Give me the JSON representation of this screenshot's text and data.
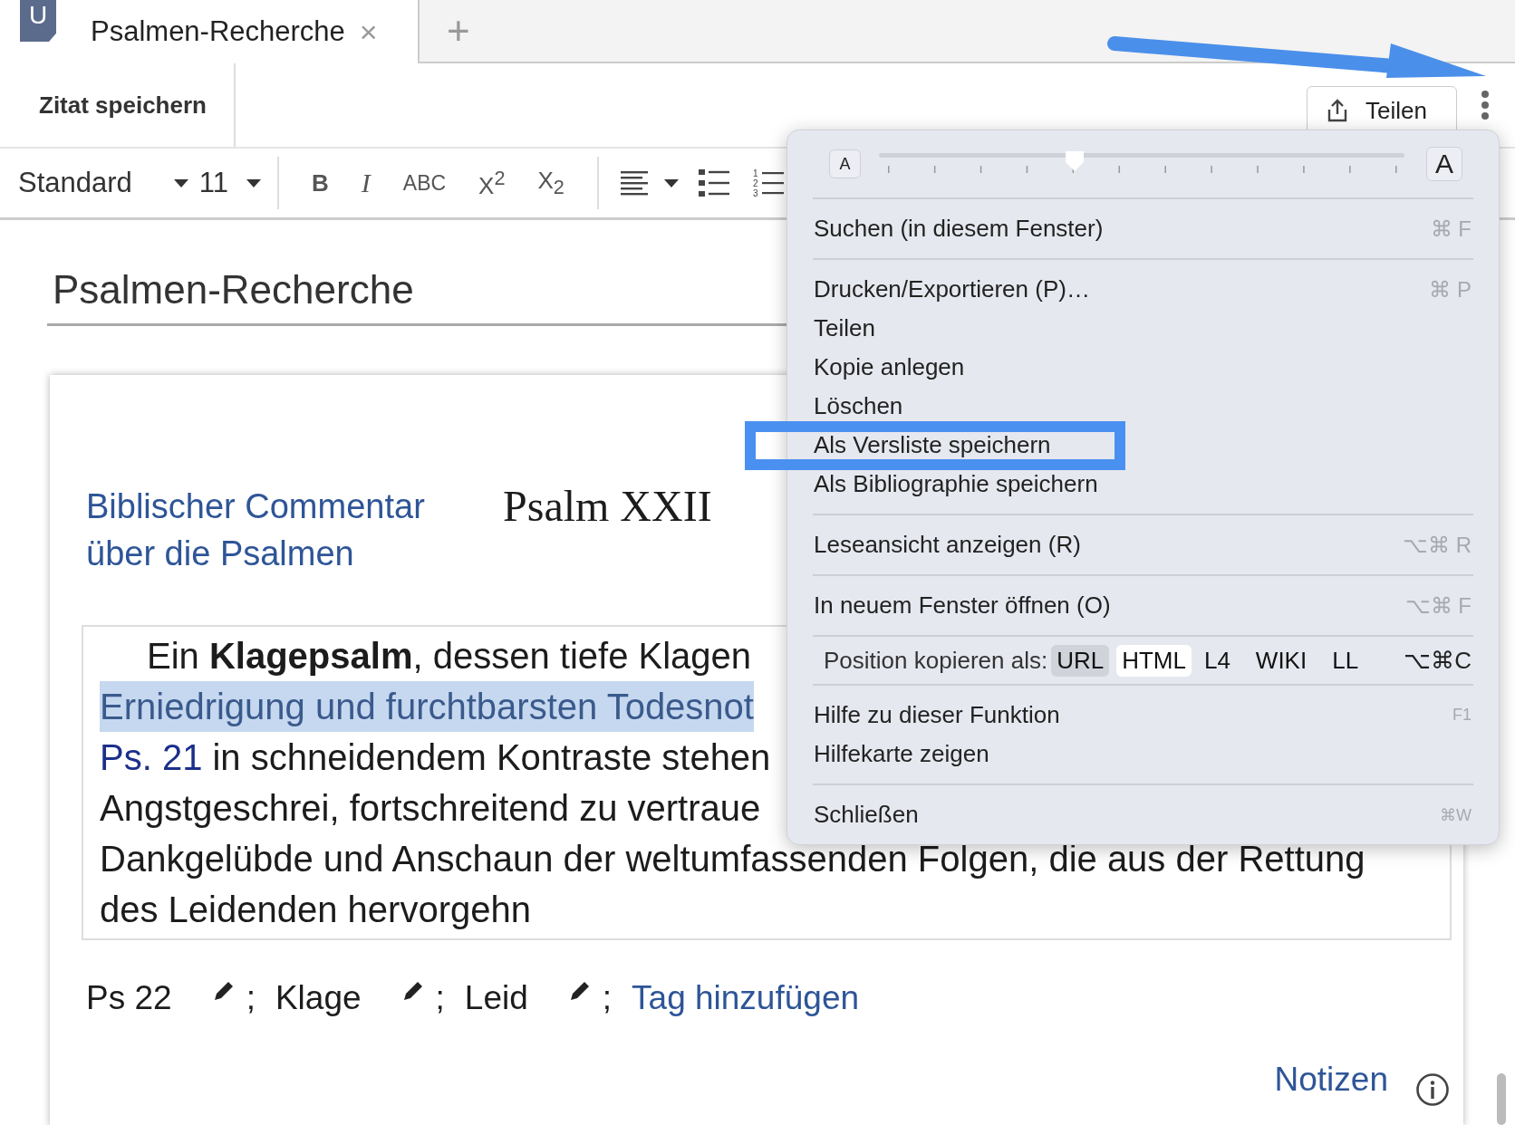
{
  "app_logo": {
    "letter": "U"
  },
  "tabs": [
    {
      "label": "Psalmen-Recherche",
      "close": "×",
      "selected": true
    }
  ],
  "new_tab": "+",
  "toolbar": {
    "save_quote": "Zitat speichern",
    "share_button": "Teilen"
  },
  "format_bar": {
    "style": "Standard",
    "size": "11",
    "buttons": [
      {
        "label": "B",
        "kind": "bold"
      },
      {
        "label": "I",
        "kind": "italic"
      },
      {
        "label": "ABC",
        "kind": "caps"
      },
      {
        "label": "X$^{2}$",
        "kind": "script"
      },
      {
        "label": "X$_{2}$",
        "kind": "script"
      }
    ],
    "list_numbers": [
      "1",
      "2",
      "3"
    ]
  },
  "document": {
    "title": "Psalmen-Recherche",
    "source_link": "Biblischer Commentar über die Psalmen",
    "heading": "Psalm XXII",
    "quote_lines": [
      {
        "text": "Ein **Klagepsalm**, dessen tiefe Klagen",
        "highlighted": false
      },
      {
        "text": "Erniedrigung und furchtbarsten Todesnot",
        "highlighted": true
      },
      {
        "link": "Ps. 21",
        "text": "in schneidendem Kontraste stehen",
        "highlighted": false
      },
      {
        "text": "Angstgeschrei, fortschreitend zu vertraue",
        "highlighted": false
      },
      {
        "text": "Dankgelübde und Anschaun der weltumfassenden Folgen, die aus der Rettung",
        "highlighted": false
      },
      {
        "text": "des Leidenden hervorgehn",
        "highlighted": false
      }
    ],
    "tags": [
      {
        "label": "Ps 22",
        "separator": ";"
      },
      {
        "label": "Klage",
        "separator": ";"
      },
      {
        "label": "Leid",
        "separator": ";"
      }
    ],
    "add_tag": "Tag hinzufügen",
    "notes_link": "Notizen"
  },
  "menu": {
    "slider": {
      "small_label": "A",
      "large_label": "A",
      "level": 0.37
    },
    "sections": [
      {
        "kind": "items",
        "items": [
          {
            "label": "Suchen (in diesem Fenster)",
            "shortcut": "⌘ F",
            "highlighted": false
          }
        ]
      },
      {
        "kind": "items",
        "items": [
          {
            "label": "Drucken/Exportieren (P)…",
            "shortcut": "⌘ P",
            "highlighted": false
          },
          {
            "label": "Teilen",
            "highlighted": false
          },
          {
            "label": "Kopie anlegen",
            "highlighted": false
          },
          {
            "label": "Löschen",
            "highlighted": false
          },
          {
            "label": "Als Versliste speichern",
            "highlighted": true
          },
          {
            "label": "Als Bibliographie speichern",
            "highlighted": false
          }
        ]
      },
      {
        "kind": "items",
        "items": [
          {
            "label": "Leseansicht anzeigen (R)",
            "shortcut": "⌥⌘ R",
            "highlighted": false
          }
        ]
      },
      {
        "kind": "items",
        "items": [
          {
            "label": "In neuem Fenster öffnen (O)",
            "shortcut": "⌥⌘ F",
            "highlighted": false
          }
        ]
      },
      {
        "kind": "copy",
        "label": "Position kopieren als:",
        "formats": [
          {
            "label": "URL",
            "selected": true,
            "hovered": false
          },
          {
            "label": "HTML",
            "selected": false,
            "hovered": true
          },
          {
            "label": "L4",
            "selected": false,
            "hovered": false
          },
          {
            "label": "WIKI",
            "selected": false,
            "hovered": false
          },
          {
            "label": "LL",
            "selected": false,
            "hovered": false
          }
        ],
        "shortcut": "⌥⌘C"
      },
      {
        "kind": "items",
        "items": [
          {
            "label": "Hilfe zu dieser Funktion",
            "shortcut": "F1",
            "highlighted": false
          },
          {
            "label": "Hilfekarte zeigen",
            "highlighted": false
          }
        ]
      },
      {
        "kind": "items",
        "items": [
          {
            "label": "Schließen",
            "shortcut": "⌘W",
            "highlighted": false
          }
        ]
      }
    ]
  }
}
